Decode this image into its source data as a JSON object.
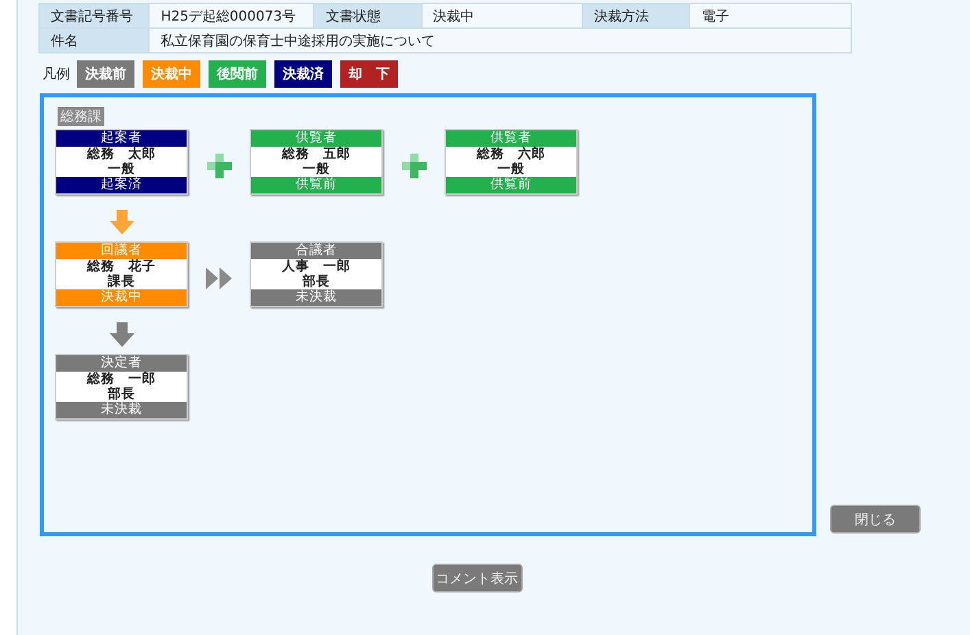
{
  "info": {
    "fields": [
      {
        "label": "文書記号番号",
        "value": "H25デ起総000073号"
      },
      {
        "label": "文書状態",
        "value": "決裁中"
      },
      {
        "label": "決裁方法",
        "value": "電子"
      }
    ],
    "subject": {
      "label": "件名",
      "value": "私立保育園の保育士中途採用の実施について"
    }
  },
  "legend": {
    "label": "凡例",
    "items": [
      {
        "text": "決裁前",
        "color": "#7a7a7a"
      },
      {
        "text": "決裁中",
        "color": "#ff8c00"
      },
      {
        "text": "後閲前",
        "color": "#22b14c"
      },
      {
        "text": "決裁済",
        "color": "#000080"
      },
      {
        "text": "却　下",
        "color": "#b22222"
      }
    ]
  },
  "route": {
    "department": "総務課",
    "rows": [
      {
        "items": [
          {
            "kind": "card",
            "role": "起案者",
            "name": "総務　太郎",
            "title": "一般",
            "status": "起案済",
            "color": "#000080"
          },
          {
            "kind": "plus"
          },
          {
            "kind": "card",
            "role": "供覧者",
            "name": "総務　五郎",
            "title": "一般",
            "status": "供覧前",
            "color": "#22b14c"
          },
          {
            "kind": "plus"
          },
          {
            "kind": "card",
            "role": "供覧者",
            "name": "総務　六郎",
            "title": "一般",
            "status": "供覧前",
            "color": "#22b14c"
          }
        ]
      },
      {
        "items": [
          {
            "kind": "down",
            "color": "#ffa436"
          }
        ]
      },
      {
        "items": [
          {
            "kind": "card",
            "role": "回議者",
            "name": "総務　花子",
            "title": "課長",
            "status": "決裁中",
            "color": "#ff8c00"
          },
          {
            "kind": "next"
          },
          {
            "kind": "card",
            "role": "合議者",
            "name": "人事　一郎",
            "title": "部長",
            "status": "未決裁",
            "color": "#7a7a7a"
          }
        ]
      },
      {
        "items": [
          {
            "kind": "down",
            "color": "#808080"
          }
        ]
      },
      {
        "items": [
          {
            "kind": "card",
            "role": "決定者",
            "name": "総務　一郎",
            "title": "部長",
            "status": "未決裁",
            "color": "#7a7a7a"
          }
        ]
      }
    ]
  },
  "buttons": {
    "close": "閉じる",
    "comment": "コメント表示"
  }
}
